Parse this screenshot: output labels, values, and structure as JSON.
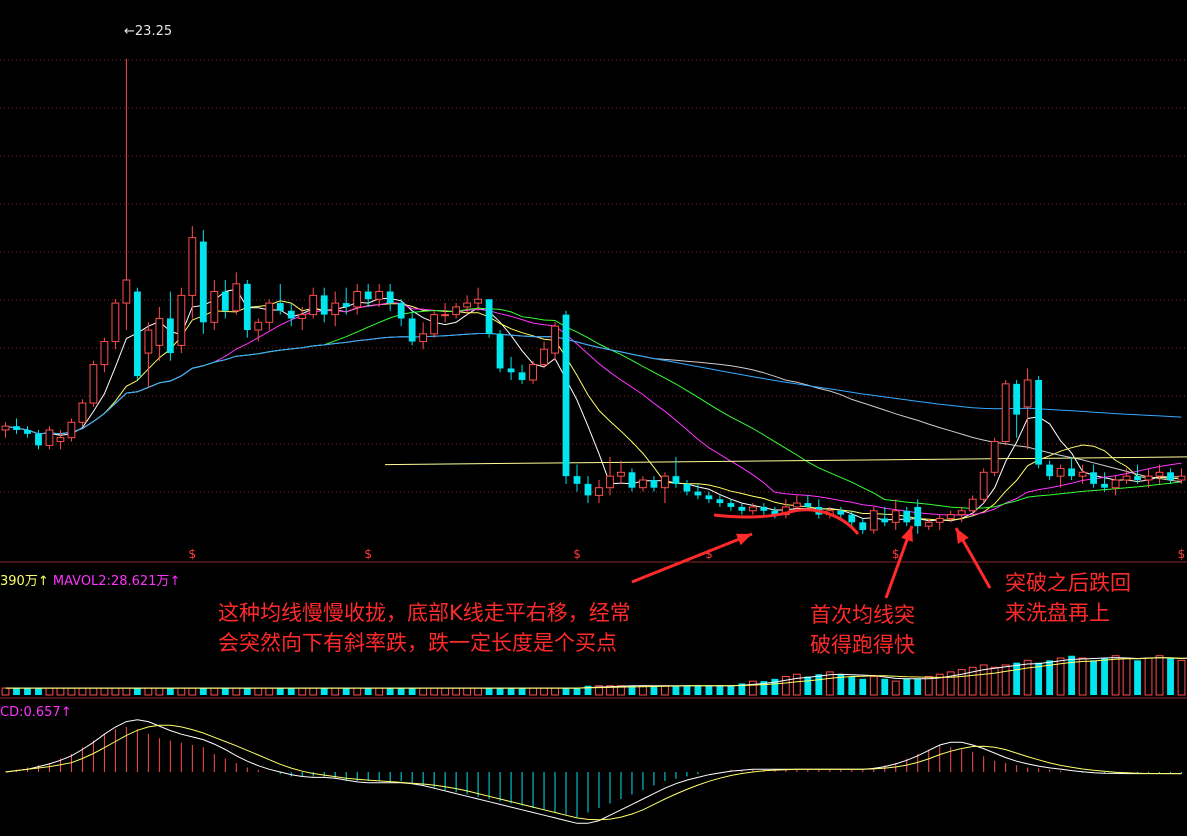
{
  "chart_data": {
    "type": "candlestick",
    "price": {
      "ylim": [
        11.0,
        24.0
      ],
      "high_marker": "23.25",
      "grid": "dotted horizontal",
      "candles": [
        [
          13.6,
          13.8,
          13.4,
          13.7
        ],
        [
          13.7,
          13.9,
          13.5,
          13.6
        ],
        [
          13.6,
          13.7,
          13.4,
          13.5
        ],
        [
          13.5,
          13.6,
          13.1,
          13.2
        ],
        [
          13.2,
          13.7,
          13.1,
          13.6
        ],
        [
          13.3,
          13.6,
          13.1,
          13.4
        ],
        [
          13.4,
          13.9,
          13.3,
          13.8
        ],
        [
          13.8,
          14.4,
          13.7,
          14.3
        ],
        [
          14.3,
          15.4,
          14.2,
          15.3
        ],
        [
          15.3,
          16.0,
          15.1,
          15.9
        ],
        [
          15.9,
          17.0,
          15.7,
          16.9
        ],
        [
          16.9,
          23.25,
          16.2,
          17.5
        ],
        [
          17.2,
          17.3,
          14.9,
          15.0
        ],
        [
          15.6,
          16.4,
          14.7,
          16.2
        ],
        [
          15.8,
          16.8,
          15.4,
          16.5
        ],
        [
          16.5,
          17.2,
          15.4,
          15.6
        ],
        [
          15.8,
          17.3,
          15.6,
          17.1
        ],
        [
          17.1,
          18.9,
          16.5,
          18.6
        ],
        [
          18.5,
          18.8,
          16.1,
          16.4
        ],
        [
          16.4,
          17.5,
          16.2,
          17.2
        ],
        [
          17.2,
          17.5,
          16.5,
          16.7
        ],
        [
          16.7,
          17.7,
          16.6,
          17.4
        ],
        [
          17.4,
          17.5,
          16.0,
          16.2
        ],
        [
          16.2,
          16.5,
          15.9,
          16.4
        ],
        [
          16.4,
          17.0,
          16.2,
          16.9
        ],
        [
          16.9,
          17.4,
          16.6,
          16.7
        ],
        [
          16.7,
          16.9,
          16.3,
          16.5
        ],
        [
          16.5,
          16.8,
          16.2,
          16.6
        ],
        [
          16.6,
          17.3,
          16.5,
          17.1
        ],
        [
          17.1,
          17.3,
          16.4,
          16.6
        ],
        [
          16.6,
          17.2,
          16.3,
          16.9
        ],
        [
          16.9,
          17.3,
          16.6,
          16.8
        ],
        [
          16.8,
          17.4,
          16.6,
          17.2
        ],
        [
          17.2,
          17.4,
          16.8,
          17.0
        ],
        [
          17.0,
          17.4,
          16.8,
          17.2
        ],
        [
          17.2,
          17.4,
          16.7,
          16.9
        ],
        [
          16.9,
          17.0,
          16.3,
          16.5
        ],
        [
          16.5,
          16.7,
          15.8,
          15.9
        ],
        [
          15.9,
          16.4,
          15.7,
          16.1
        ],
        [
          16.1,
          16.7,
          16.0,
          16.6
        ],
        [
          16.6,
          16.9,
          16.4,
          16.6
        ],
        [
          16.6,
          16.9,
          16.5,
          16.8
        ],
        [
          16.8,
          17.1,
          16.6,
          16.9
        ],
        [
          16.9,
          17.3,
          16.7,
          17.0
        ],
        [
          17.0,
          17.0,
          16.0,
          16.1
        ],
        [
          16.1,
          16.2,
          15.1,
          15.2
        ],
        [
          15.2,
          15.5,
          14.9,
          15.1
        ],
        [
          15.1,
          15.3,
          14.8,
          14.9
        ],
        [
          14.9,
          15.4,
          14.8,
          15.3
        ],
        [
          15.3,
          15.9,
          15.2,
          15.7
        ],
        [
          15.6,
          16.4,
          15.4,
          16.3
        ],
        [
          16.6,
          16.7,
          12.2,
          12.4
        ],
        [
          12.4,
          12.7,
          12.0,
          12.2
        ],
        [
          12.2,
          12.4,
          11.7,
          11.9
        ],
        [
          11.9,
          12.3,
          11.7,
          12.1
        ],
        [
          12.1,
          12.9,
          11.9,
          12.4
        ],
        [
          12.4,
          12.8,
          12.2,
          12.5
        ],
        [
          12.5,
          12.6,
          12.0,
          12.1
        ],
        [
          12.1,
          12.4,
          12.0,
          12.3
        ],
        [
          12.3,
          12.4,
          12.0,
          12.1
        ],
        [
          12.1,
          12.5,
          11.7,
          12.4
        ],
        [
          12.4,
          12.9,
          12.1,
          12.2
        ],
        [
          12.2,
          12.3,
          11.9,
          12.0
        ],
        [
          12.0,
          12.2,
          11.8,
          11.9
        ],
        [
          11.9,
          12.0,
          11.7,
          11.8
        ],
        [
          11.8,
          11.9,
          11.6,
          11.7
        ],
        [
          11.7,
          11.8,
          11.5,
          11.6
        ],
        [
          11.6,
          11.7,
          11.4,
          11.5
        ],
        [
          11.5,
          11.7,
          11.4,
          11.6
        ],
        [
          11.6,
          11.7,
          11.4,
          11.5
        ],
        [
          11.5,
          11.6,
          11.3,
          11.4
        ],
        [
          11.4,
          11.8,
          11.3,
          11.6
        ],
        [
          11.6,
          11.9,
          11.5,
          11.7
        ],
        [
          11.7,
          11.9,
          11.5,
          11.6
        ],
        [
          11.6,
          11.8,
          11.3,
          11.4
        ],
        [
          11.4,
          11.6,
          11.3,
          11.5
        ],
        [
          11.5,
          11.6,
          11.3,
          11.4
        ],
        [
          11.4,
          11.5,
          11.1,
          11.2
        ],
        [
          11.2,
          11.3,
          10.9,
          11.0
        ],
        [
          11.0,
          11.6,
          10.9,
          11.5
        ],
        [
          11.3,
          11.6,
          11.1,
          11.2
        ],
        [
          11.2,
          11.8,
          11.0,
          11.5
        ],
        [
          11.5,
          11.6,
          11.1,
          11.2
        ],
        [
          11.6,
          11.8,
          10.9,
          11.1
        ],
        [
          11.1,
          11.3,
          11.0,
          11.2
        ],
        [
          11.2,
          11.4,
          11.0,
          11.3
        ],
        [
          11.3,
          11.5,
          11.2,
          11.4
        ],
        [
          11.4,
          11.6,
          11.2,
          11.5
        ],
        [
          11.5,
          11.9,
          11.4,
          11.8
        ],
        [
          11.8,
          12.6,
          11.7,
          12.5
        ],
        [
          12.5,
          13.4,
          12.4,
          13.3
        ],
        [
          13.3,
          14.9,
          13.2,
          14.8
        ],
        [
          14.8,
          14.9,
          13.4,
          14.0
        ],
        [
          14.2,
          15.2,
          13.1,
          14.9
        ],
        [
          14.9,
          15.0,
          12.6,
          12.7
        ],
        [
          12.7,
          12.8,
          12.3,
          12.4
        ],
        [
          12.4,
          12.7,
          12.1,
          12.6
        ],
        [
          12.6,
          12.9,
          12.3,
          12.4
        ],
        [
          12.4,
          12.7,
          12.2,
          12.5
        ],
        [
          12.5,
          12.7,
          12.1,
          12.2
        ],
        [
          12.2,
          12.5,
          12.0,
          12.1
        ],
        [
          12.1,
          12.4,
          11.9,
          12.3
        ],
        [
          12.3,
          12.6,
          12.2,
          12.4
        ],
        [
          12.4,
          12.7,
          12.2,
          12.3
        ],
        [
          12.3,
          12.6,
          12.1,
          12.4
        ],
        [
          12.4,
          12.7,
          12.2,
          12.5
        ],
        [
          12.5,
          12.6,
          12.2,
          12.3
        ],
        [
          12.3,
          12.6,
          12.2,
          12.4
        ]
      ],
      "sell_markers": [
        17,
        33,
        52,
        64,
        81,
        111
      ]
    },
    "volume": {
      "legend": [
        "390万",
        "MAVOL2:28.621万"
      ],
      "legend_arrows": [
        "↑",
        "↑"
      ],
      "values": [
        3,
        3,
        3,
        3,
        3,
        3,
        3,
        3,
        3,
        3,
        3,
        3,
        3,
        3,
        3,
        3,
        3,
        3,
        3,
        3,
        3,
        3,
        3,
        3,
        3,
        3,
        3,
        3,
        3,
        3,
        3,
        3,
        3,
        3,
        3,
        3,
        3,
        3,
        3,
        3,
        3,
        3,
        3,
        3,
        3,
        3,
        3,
        3,
        3,
        3,
        3,
        3,
        3,
        4,
        4,
        4,
        4,
        4,
        4,
        4,
        4,
        4,
        4,
        4,
        4,
        4,
        4,
        5,
        6,
        6,
        7,
        8,
        9,
        8,
        9,
        10,
        9,
        8,
        7,
        8,
        7,
        6,
        7,
        7,
        8,
        9,
        10,
        11,
        12,
        13,
        12,
        13,
        14,
        15,
        14,
        15,
        16,
        17,
        16,
        15,
        16,
        17,
        16,
        15,
        16,
        17,
        16,
        15,
        16,
        15,
        16,
        17,
        16
      ]
    },
    "macd": {
      "legend": "CD:0.657",
      "legend_arrow": "↑",
      "values": [
        0.0,
        0.05,
        0.1,
        0.15,
        0.2,
        0.3,
        0.4,
        0.55,
        0.7,
        0.85,
        0.95,
        1.0,
        0.95,
        0.85,
        0.75,
        0.7,
        0.65,
        0.6,
        0.55,
        0.4,
        0.3,
        0.2,
        0.1,
        0.05,
        0.0,
        -0.05,
        -0.1,
        -0.1,
        -0.1,
        -0.1,
        -0.15,
        -0.2,
        -0.2,
        -0.2,
        -0.2,
        -0.2,
        -0.2,
        -0.25,
        -0.3,
        -0.35,
        -0.4,
        -0.45,
        -0.5,
        -0.55,
        -0.6,
        -0.65,
        -0.7,
        -0.75,
        -0.8,
        -0.85,
        -0.9,
        -0.95,
        -1.0,
        -0.9,
        -0.8,
        -0.7,
        -0.6,
        -0.5,
        -0.4,
        -0.3,
        -0.2,
        -0.15,
        -0.1,
        -0.05,
        0.0,
        0.0,
        0.05,
        0.05,
        0.05,
        0.05,
        0.05,
        0.05,
        0.05,
        0.05,
        0.05,
        0.05,
        0.05,
        0.05,
        0.05,
        0.1,
        0.15,
        0.2,
        0.3,
        0.4,
        0.5,
        0.6,
        0.55,
        0.5,
        0.45,
        0.35,
        0.25,
        0.2,
        0.15,
        0.1,
        0.08,
        0.05,
        0.03,
        0.0,
        -0.02,
        -0.02,
        -0.03,
        -0.03,
        -0.03,
        -0.03,
        -0.03,
        -0.03,
        -0.03,
        -0.03,
        -0.03,
        -0.03,
        -0.03,
        -0.03,
        -0.03
      ]
    }
  },
  "annotations": {
    "left_line1": "这种均线慢慢收拢，底部K线走平右移，经常",
    "left_line2": "会突然向下有斜率跌，跌一定长度是个买点",
    "mid_line1": "首次均线突",
    "mid_line2": "破得跑得快",
    "right_line1": "突破之后跌回",
    "right_line2": "来洗盘再上"
  },
  "colors": {
    "up": "#ff4d4d",
    "down": "#00e5ee",
    "ma5": "#ffffff",
    "ma10": "#ffff66",
    "ma20": "#ff33ff",
    "ma30": "#33ff33",
    "ma60": "#cccccc",
    "ma120": "#33aaff",
    "ma250": "#ffff99",
    "annotation": "#ff2a2a",
    "vol_legend1": "#ffff66",
    "vol_legend2": "#ff33ff",
    "macd_legend": "#ff33ff"
  }
}
